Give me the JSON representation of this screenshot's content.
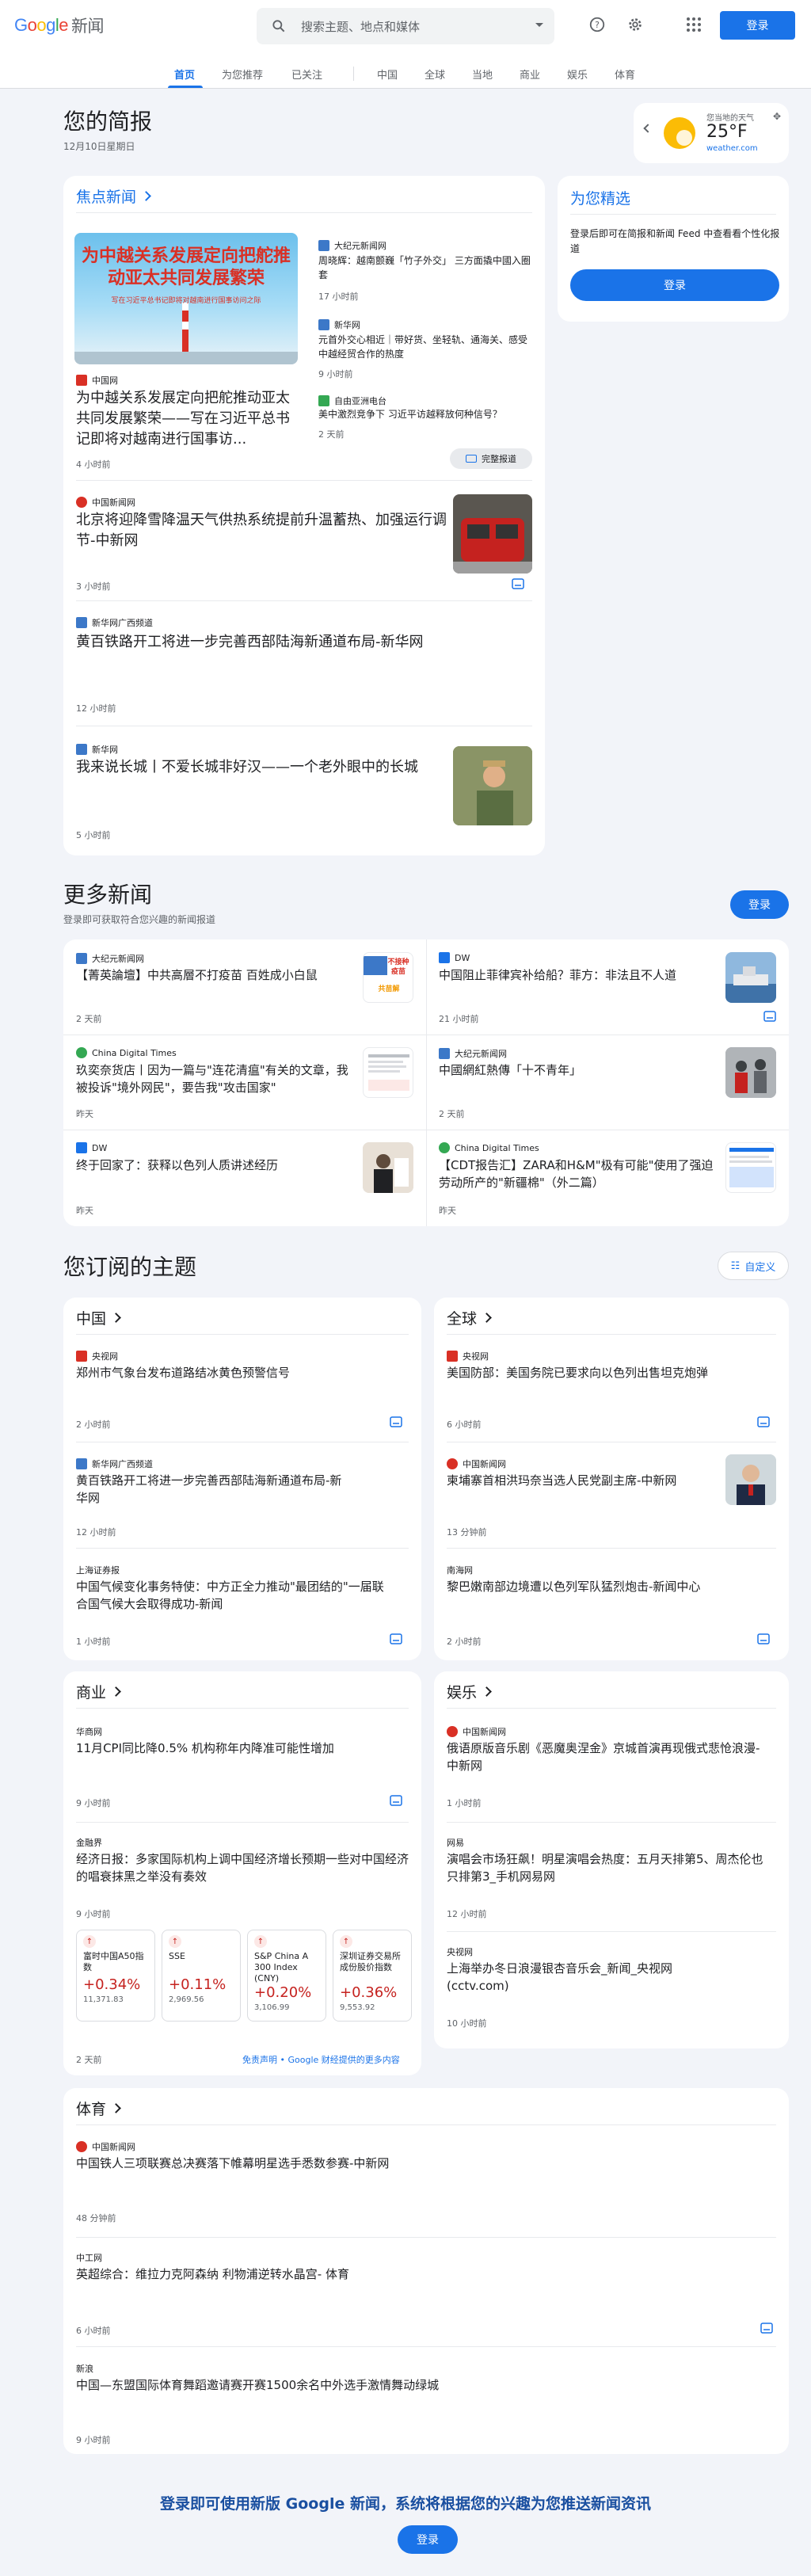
{
  "header": {
    "logo_letters": [
      "G",
      "o",
      "o",
      "g",
      "l",
      "e"
    ],
    "logo_colors": [
      "#4285f4",
      "#ea4335",
      "#fbbc05",
      "#4285f4",
      "#34a853",
      "#ea4335"
    ],
    "logo_suffix": "新闻",
    "search_placeholder": "搜索主题、地点和媒体",
    "signin": "登录",
    "icons": [
      "search-icon",
      "chevron-down-icon",
      "help-icon",
      "settings-icon",
      "apps-icon"
    ]
  },
  "nav": {
    "tabs": [
      "首页",
      "为您推荐",
      "已关注",
      "中国",
      "全球",
      "当地",
      "商业",
      "娱乐",
      "体育"
    ],
    "active": "首页"
  },
  "brief": {
    "title": "您的简报",
    "date": "12月10日星期日"
  },
  "weather": {
    "label": "您当地的天气",
    "temp": "25°F",
    "source": "weather.com"
  },
  "top": {
    "heading": "焦点新闻",
    "main": {
      "source": "中国网",
      "title": "为中越关系发展定向把舵推动亚太共同发展繁荣——写在习近平总书记即将对越南进行国事访...",
      "time": "4 小时前",
      "image_text": "为中越关系发展定向把舵推动亚太共同发展繁荣",
      "image_sub": "写在习近平总书记即将对越南进行国事访问之际"
    },
    "side": [
      {
        "source": "大纪元新闻网",
        "title": "周晓辉：越南颤巍「竹子外交」 三方面撬中國入圈套",
        "time": "17 小时前"
      },
      {
        "source": "新华网",
        "title": "元首外交心相近｜带好货、坐轻轨、通海关、感受中越经贸合作的热度",
        "time": "9 小时前"
      },
      {
        "source": "自由亚洲电台",
        "title": "美中激烈竞争下 习近平访越释放何种信号？",
        "time": "2 天前"
      }
    ],
    "full_coverage": "完整报道",
    "stories": [
      {
        "source": "中国新闻网",
        "title": "北京将迎降雪降温天气供热系统提前升温蓄热、加强运行调节-中新网",
        "time": "3 小时前"
      },
      {
        "source": "新华网广西频道",
        "title": "黄百铁路开工将进一步完善西部陆海新通道布局-新华网",
        "time": "12 小时前"
      },
      {
        "source": "新华网",
        "title": "我来说长城丨不爱长城非好汉——一个老外眼中的长城",
        "time": "5 小时前"
      }
    ]
  },
  "picks": {
    "heading": "为您精选",
    "text": "登录后即可在简报和新闻 Feed 中查看看个性化报道",
    "button": "登录"
  },
  "more": {
    "title": "更多新闻",
    "subtitle": "登录即可获取符合您兴趣的新闻报道",
    "button": "登录",
    "items": [
      {
        "source": "大纪元新闻网",
        "title": "【菁英論壇】中共高層不打疫苗 百姓成小白鼠",
        "time": "2 天前"
      },
      {
        "source": "DW",
        "title": "中国阻止菲律宾补给船？菲方：非法且不人道",
        "time": "21 小时前"
      },
      {
        "source": "China Digital Times",
        "title": "玖奕奈货店丨因为一篇与\"连花清瘟\"有关的文章，我被投诉\"境外网民\"，要告我\"攻击国家\"",
        "time": "昨天"
      },
      {
        "source": "大纪元新闻网",
        "title": "中國網紅熱傳「十不青年」",
        "time": "2 天前"
      },
      {
        "source": "DW",
        "title": "终于回家了：获释以色列人质讲述经历",
        "time": "昨天"
      },
      {
        "source": "China Digital Times",
        "title": "【CDT报告汇】ZARA和H&M\"极有可能\"使用了强迫劳动所产的\"新疆棉\"（外二篇）",
        "time": "昨天"
      }
    ]
  },
  "topics": {
    "title": "您订阅的主题",
    "customize": "自定义",
    "china": {
      "heading": "中国",
      "items": [
        {
          "source": "央视网",
          "title": "郑州市气象台发布道路结冰黄色预警信号",
          "time": "2 小时前"
        },
        {
          "source": "新华网广西频道",
          "title": "黄百铁路开工将进一步完善西部陆海新通道布局-新华网",
          "time": "12 小时前"
        },
        {
          "source": "上海证券报",
          "title": "中国气候变化事务特使：中方正全力推动\"最团结的\"一届联合国气候大会取得成功-新闻",
          "time": "1 小时前"
        }
      ]
    },
    "world": {
      "heading": "全球",
      "items": [
        {
          "source": "央视网",
          "title": "美国防部：美国务院已要求向以色列出售坦克炮弹",
          "time": "6 小时前"
        },
        {
          "source": "中国新闻网",
          "title": "柬埔寨首相洪玛奈当选人民党副主席-中新网",
          "time": "13 分钟前"
        },
        {
          "source": "南海网",
          "title": "黎巴嫩南部边境遭以色列军队猛烈炮击-新闻中心",
          "time": "2 小时前"
        }
      ]
    },
    "business": {
      "heading": "商业",
      "items": [
        {
          "source": "华商网",
          "title": "11月CPI同比降0.5% 机构称年内降准可能性增加",
          "time": "9 小时前"
        },
        {
          "source": "金融界",
          "title": "经济日报：多家国际机构上调中国经济增长预期一些对中国经济的唱衰抹黑之举没有奏效",
          "time": "9 小时前"
        }
      ],
      "stocks": [
        {
          "name": "富时中国A50指数",
          "pct": "+0.34%",
          "val": "11,371.83"
        },
        {
          "name": "SSE",
          "pct": "+0.11%",
          "val": "2,969.56"
        },
        {
          "name": "S&P China A 300 Index (CNY)",
          "pct": "+0.20%",
          "val": "3,106.99"
        },
        {
          "name": "深圳证券交易所成份股价指数",
          "pct": "+0.36%",
          "val": "9,553.92"
        }
      ],
      "stocks_time": "2 天前",
      "disclaimer": "免责声明 • Google 财经提供的更多内容"
    },
    "ent": {
      "heading": "娱乐",
      "items": [
        {
          "source": "中国新闻网",
          "title": "俄语原版音乐剧《恶魔奥涅金》京城首演再现俄式悲怆浪漫-中新网",
          "time": "1 小时前"
        },
        {
          "source": "网易",
          "title": "演唱会市场狂飙！明星演唱会热度：五月天排第5、周杰伦也只排第3_手机网易网",
          "time": "12 小时前"
        },
        {
          "source": "央视网",
          "title": "上海举办冬日浪漫银杏音乐会_新闻_央视网(cctv.com)",
          "time": "10 小时前"
        }
      ]
    },
    "sports": {
      "heading": "体育",
      "items": [
        {
          "source": "中国新闻网",
          "title": "中国铁人三项联赛总决赛落下帷幕明星选手悉数参赛-中新网",
          "time": "48 分钟前"
        },
        {
          "source": "中工网",
          "title": "英超综合：维拉力克阿森纳 利物浦逆转水晶宫- 体育",
          "time": "6 小时前"
        },
        {
          "source": "新浪",
          "title": "中国—东盟国际体育舞蹈邀请赛开赛1500余名中外选手激情舞动绿城",
          "time": "9 小时前"
        }
      ]
    }
  },
  "footer": {
    "text": "登录即可使用新版 Google 新闻，系统将根据您的兴趣为您推送新闻资讯",
    "button": "登录"
  }
}
